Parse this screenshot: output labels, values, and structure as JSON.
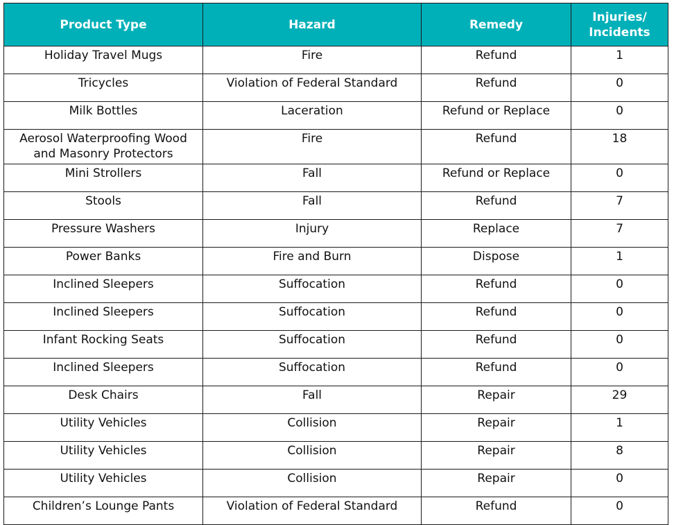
{
  "table": {
    "header_color": "#00b0b9",
    "columns": [
      {
        "key": "product",
        "label_lines": [
          "Product Type"
        ]
      },
      {
        "key": "hazard",
        "label_lines": [
          "Hazard"
        ]
      },
      {
        "key": "remedy",
        "label_lines": [
          "Remedy"
        ]
      },
      {
        "key": "injuries",
        "label_lines": [
          "Injuries/",
          "Incidents"
        ]
      }
    ],
    "rows": [
      {
        "product": [
          "Holiday Travel Mugs"
        ],
        "hazard": "Fire",
        "remedy": "Refund",
        "injuries": "1"
      },
      {
        "product": [
          "Tricycles"
        ],
        "hazard": "Violation of Federal Standard",
        "remedy": "Refund",
        "injuries": "0"
      },
      {
        "product": [
          "Milk Bottles"
        ],
        "hazard": "Laceration",
        "remedy": "Refund or Replace",
        "injuries": "0"
      },
      {
        "product": [
          "Aerosol Waterproofing Wood",
          "and Masonry Protectors"
        ],
        "hazard": "Fire",
        "remedy": "Refund",
        "injuries": "18"
      },
      {
        "product": [
          "Mini Strollers"
        ],
        "hazard": "Fall",
        "remedy": "Refund or Replace",
        "injuries": "0"
      },
      {
        "product": [
          "Stools"
        ],
        "hazard": "Fall",
        "remedy": "Refund",
        "injuries": "7"
      },
      {
        "product": [
          "Pressure Washers"
        ],
        "hazard": "Injury",
        "remedy": "Replace",
        "injuries": "7"
      },
      {
        "product": [
          "Power Banks"
        ],
        "hazard": "Fire and Burn",
        "remedy": "Dispose",
        "injuries": "1"
      },
      {
        "product": [
          "Inclined Sleepers"
        ],
        "hazard": "Suffocation",
        "remedy": "Refund",
        "injuries": "0"
      },
      {
        "product": [
          "Inclined Sleepers"
        ],
        "hazard": "Suffocation",
        "remedy": "Refund",
        "injuries": "0"
      },
      {
        "product": [
          "Infant Rocking Seats"
        ],
        "hazard": "Suffocation",
        "remedy": "Refund",
        "injuries": "0"
      },
      {
        "product": [
          "Inclined Sleepers"
        ],
        "hazard": "Suffocation",
        "remedy": "Refund",
        "injuries": "0"
      },
      {
        "product": [
          "Desk Chairs"
        ],
        "hazard": "Fall",
        "remedy": "Repair",
        "injuries": "29"
      },
      {
        "product": [
          "Utility Vehicles"
        ],
        "hazard": "Collision",
        "remedy": "Repair",
        "injuries": "1"
      },
      {
        "product": [
          "Utility Vehicles"
        ],
        "hazard": "Collision",
        "remedy": "Repair",
        "injuries": "8"
      },
      {
        "product": [
          "Utility Vehicles"
        ],
        "hazard": "Collision",
        "remedy": "Repair",
        "injuries": "0"
      },
      {
        "product": [
          "Children’s Lounge Pants"
        ],
        "hazard": "Violation of Federal Standard",
        "remedy": "Refund",
        "injuries": "0"
      }
    ]
  }
}
